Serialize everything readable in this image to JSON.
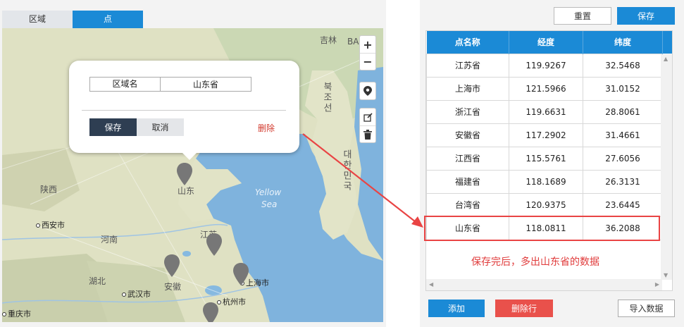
{
  "tabs": [
    {
      "label": "区域",
      "active": false
    },
    {
      "label": "点",
      "active": true
    }
  ],
  "map": {
    "labels": {
      "jilin": "吉林",
      "baishan_partial": "BA",
      "korea_north": "북조선",
      "korea_south": "대한민국",
      "shanxi": "陕西",
      "xian": "西安市",
      "henan": "河南",
      "hubei": "湖北",
      "wuhan": "武汉市",
      "chongqing": "重庆市",
      "shandong": "山东",
      "jiangsu": "江苏",
      "anhui": "安徽",
      "shanghai": "上海市",
      "hangzhou": "杭州市",
      "yellow_sea_1": "Yellow",
      "yellow_sea_2": "Sea"
    },
    "controls": {
      "zoom_in": "+",
      "zoom_out": "−"
    }
  },
  "popup": {
    "field_label": "区域名",
    "field_value": "山东省",
    "save_label": "保存",
    "cancel_label": "取消",
    "delete_label": "删除"
  },
  "toolbar": {
    "reset_label": "重置",
    "save_label": "保存"
  },
  "table": {
    "columns": [
      "点名称",
      "经度",
      "纬度"
    ],
    "rows": [
      [
        "江苏省",
        "119.9267",
        "32.5468"
      ],
      [
        "上海市",
        "121.5966",
        "31.0152"
      ],
      [
        "浙江省",
        "119.6631",
        "28.8061"
      ],
      [
        "安徽省",
        "117.2902",
        "31.4661"
      ],
      [
        "江西省",
        "115.5761",
        "27.6056"
      ],
      [
        "福建省",
        "118.1689",
        "26.3131"
      ],
      [
        "台湾省",
        "120.9375",
        "23.6445"
      ],
      [
        "山东省",
        "118.0811",
        "36.2088"
      ]
    ]
  },
  "bottom": {
    "add_label": "添加",
    "delete_row_label": "删除行",
    "import_label": "导入数据"
  },
  "annotation": {
    "note": "保存完后，多出山东省的数据",
    "color": "#e94444"
  },
  "colors": {
    "accent": "#1b8ad6",
    "danger": "#e9514b",
    "dark_button": "#2e3e52"
  }
}
